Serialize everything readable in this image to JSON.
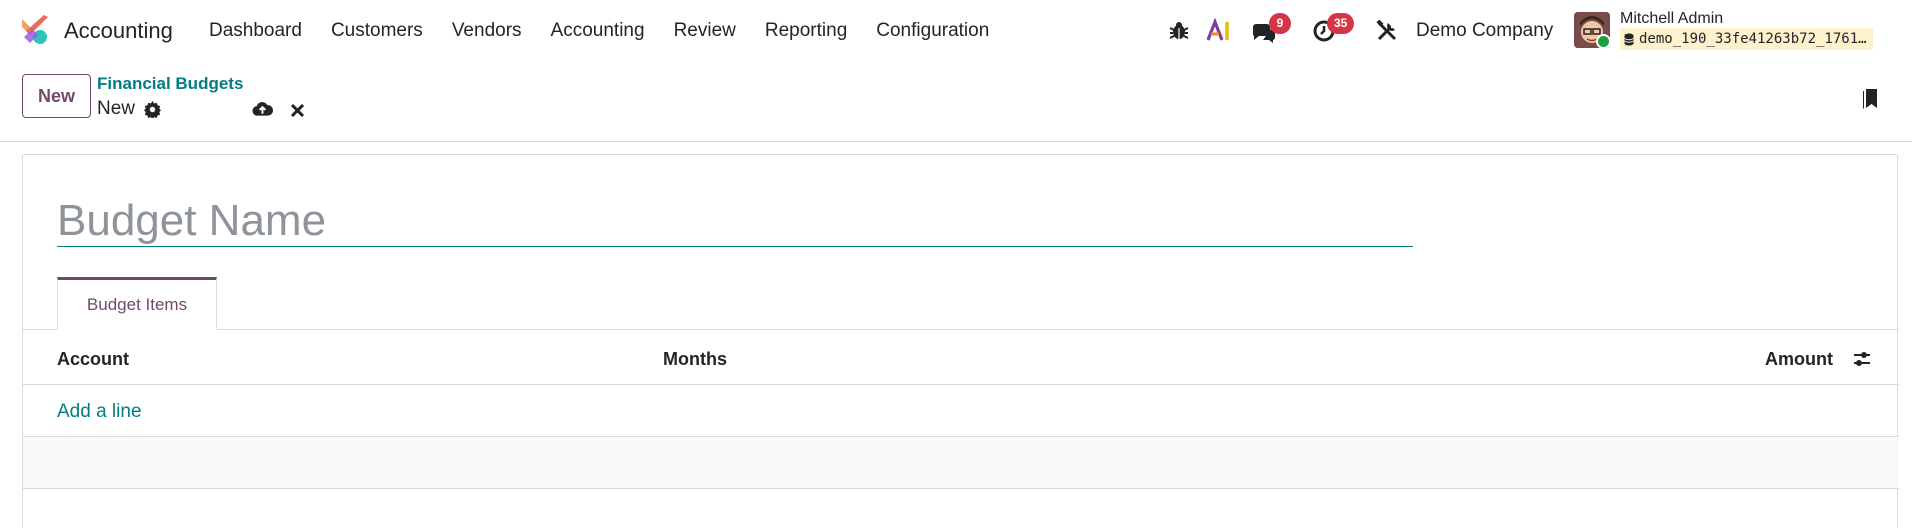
{
  "navbar": {
    "app_name": "Accounting",
    "menu": [
      "Dashboard",
      "Customers",
      "Vendors",
      "Accounting",
      "Review",
      "Reporting",
      "Configuration"
    ],
    "messages_count": "9",
    "activities_count": "35",
    "company": "Demo Company",
    "user_name": "Mitchell Admin",
    "database": "demo_190_33fe41263b72_1761…",
    "icons": [
      "debug-icon",
      "ai-icon",
      "chat-icon",
      "clock-icon",
      "tools-icon",
      "database-icon"
    ]
  },
  "control_panel": {
    "new_label": "New",
    "breadcrumb_parent": "Financial Budgets",
    "breadcrumb_current": "New",
    "icons": [
      "gear-icon",
      "cloud-upload-icon",
      "close-icon",
      "bookmark-icon"
    ]
  },
  "form": {
    "name_placeholder": "Budget Name",
    "name_value": "",
    "tab_label": "Budget Items",
    "columns": [
      "Account",
      "Months",
      "Amount"
    ],
    "add_line_label": "Add a line"
  },
  "colors": {
    "brand": "#71496a",
    "link": "#017e84",
    "badge": "#d63545",
    "status_online": "#1e9e40",
    "db_bg": "#fdf2cc"
  }
}
